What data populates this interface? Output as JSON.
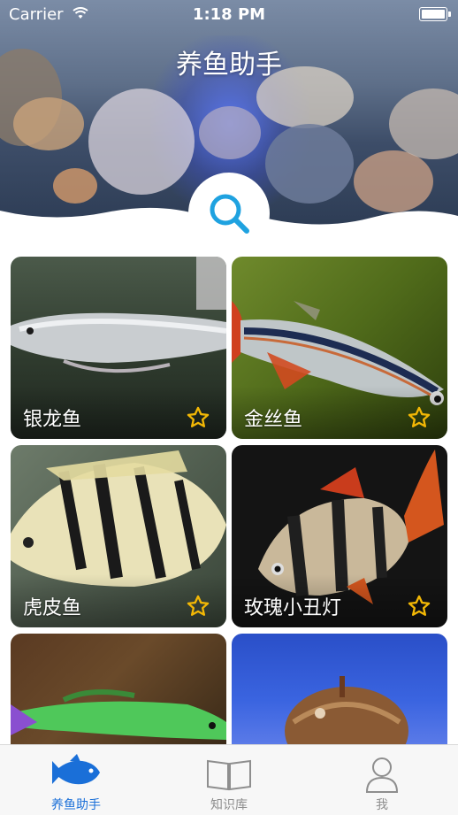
{
  "status_bar": {
    "carrier": "Carrier",
    "time": "1:18 PM"
  },
  "header": {
    "title": "养鱼助手"
  },
  "search": {
    "icon": "search-icon"
  },
  "fish_cards": [
    {
      "name": "银龙鱼",
      "favorite_icon": "star-outline-icon"
    },
    {
      "name": "金丝鱼",
      "favorite_icon": "star-outline-icon"
    },
    {
      "name": "虎皮鱼",
      "favorite_icon": "star-outline-icon"
    },
    {
      "name": "玫瑰小丑灯",
      "favorite_icon": "star-outline-icon"
    }
  ],
  "tabbar": {
    "tabs": [
      {
        "label": "养鱼助手",
        "icon": "fish-icon",
        "active": true
      },
      {
        "label": "知识库",
        "icon": "book-icon",
        "active": false
      },
      {
        "label": "我",
        "icon": "person-icon",
        "active": false
      }
    ]
  },
  "colors": {
    "accent": "#1a6fd8",
    "star": "#f2b705",
    "search": "#1fa2e0"
  }
}
